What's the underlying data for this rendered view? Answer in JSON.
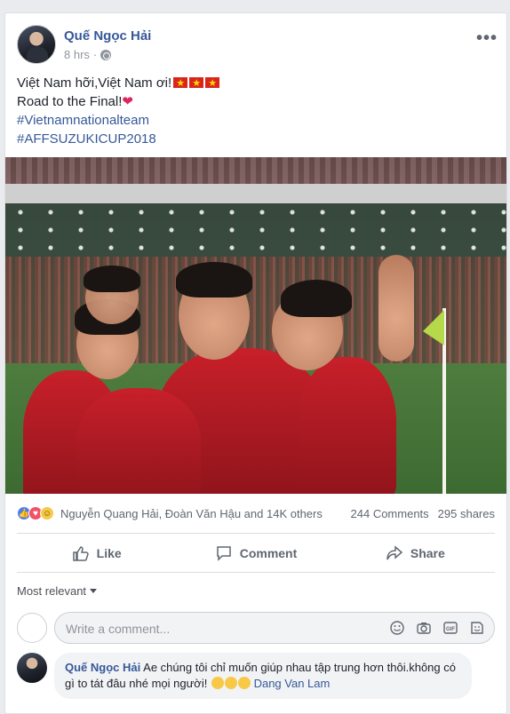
{
  "post": {
    "author": "Quế Ngọc Hải",
    "time": "8 hrs",
    "line1": "Việt Nam hỡi,Việt Nam ơi!",
    "line2": "Road to the Final!",
    "heart": "❤",
    "hashtag1": "#Vietnamnationalteam",
    "hashtag2": "#AFFSUZUKICUP2018",
    "more_icon": "•••"
  },
  "reactions": {
    "names": "Nguyễn Quang Hải, Đoàn Văn Hậu and 14K others",
    "comments": "244 Comments",
    "shares": "295 shares"
  },
  "actions": {
    "like": "Like",
    "comment": "Comment",
    "share": "Share"
  },
  "comments_section": {
    "sort_label": "Most relevant",
    "placeholder": "Write a comment...",
    "items": [
      {
        "author": "Quế Ngọc Hải",
        "text": "Ae chúng tôi chỉ muốn giúp nhau tập trung hơn thôi.không có gì to tát đâu nhé mọi người!",
        "mention": "Dang Van Lam"
      }
    ]
  },
  "colors": {
    "link": "#365899",
    "background": "#e9ebee",
    "jersey": "#c8202a"
  }
}
